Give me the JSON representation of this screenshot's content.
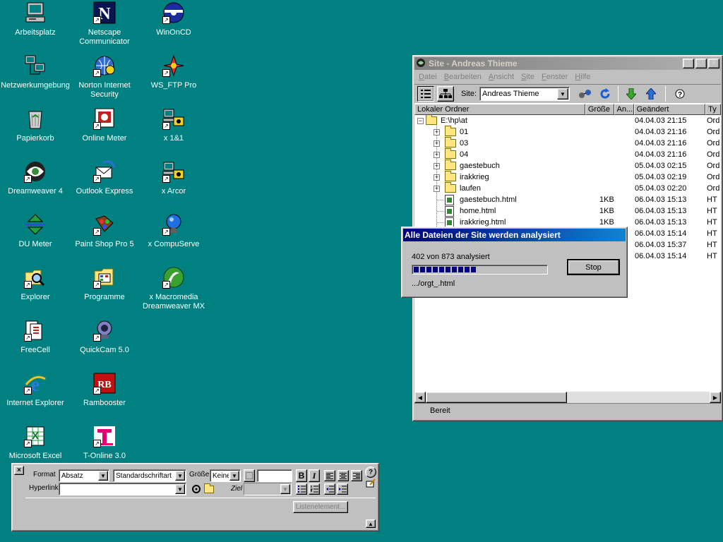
{
  "desktop_icons": [
    {
      "label": "Arbeitsplatz",
      "icon": "my-computer-icon"
    },
    {
      "label": "Netscape Communicator",
      "icon": "netscape-icon"
    },
    {
      "label": "WinOnCD",
      "icon": "winoncd-icon"
    },
    {
      "label": "Netzwerkumgebung",
      "icon": "network-neighborhood-icon"
    },
    {
      "label": "Norton Internet Security",
      "icon": "norton-icon"
    },
    {
      "label": "WS_FTP Pro",
      "icon": "ws-ftp-icon"
    },
    {
      "label": "Papierkorb",
      "icon": "recycle-bin-icon"
    },
    {
      "label": "Online Meter",
      "icon": "online-meter-icon"
    },
    {
      "label": "x 1&1",
      "icon": "dialup-icon"
    },
    {
      "label": "Dreamweaver 4",
      "icon": "dreamweaver-icon"
    },
    {
      "label": "Outlook Express",
      "icon": "outlook-express-icon"
    },
    {
      "label": "x Arcor",
      "icon": "dialup-icon"
    },
    {
      "label": "DU Meter",
      "icon": "du-meter-icon"
    },
    {
      "label": "Paint Shop Pro 5",
      "icon": "paint-shop-pro-icon"
    },
    {
      "label": "x CompuServe",
      "icon": "compuserve-icon"
    },
    {
      "label": "Explorer",
      "icon": "explorer-icon"
    },
    {
      "label": "Programme",
      "icon": "programs-icon"
    },
    {
      "label": "x Macromedia Dreamweaver MX",
      "icon": "dreamweaver-mx-icon"
    },
    {
      "label": "FreeCell",
      "icon": "freecell-icon"
    },
    {
      "label": "QuickCam 5.0",
      "icon": "quickcam-icon"
    },
    {
      "label": "Internet Explorer",
      "icon": "internet-explorer-icon"
    },
    {
      "label": "Rambooster",
      "icon": "rambooster-icon"
    },
    {
      "label": "Microsoft Excel",
      "icon": "excel-icon"
    },
    {
      "label": "T-Online 3.0",
      "icon": "t-online-icon"
    }
  ],
  "site_window": {
    "title": "Site - Andreas Thieme",
    "menu": [
      "Datei",
      "Bearbeiten",
      "Ansicht",
      "Site",
      "Fenster",
      "Hilfe"
    ],
    "site_label": "Site:",
    "site_value": "Andreas Thieme",
    "columns": [
      "Lokaler Ordner",
      "Größe",
      "An...",
      "Geändert",
      "Ty"
    ],
    "rows": [
      {
        "name": "E:\\hp\\at",
        "size": "",
        "date": "04.04.03 21:15",
        "type": "Ord",
        "kind": "folder",
        "level": 0,
        "expander": "−"
      },
      {
        "name": "01",
        "size": "",
        "date": "04.04.03 21:16",
        "type": "Ord",
        "kind": "folder",
        "level": 1,
        "expander": "+"
      },
      {
        "name": "03",
        "size": "",
        "date": "04.04.03 21:16",
        "type": "Ord",
        "kind": "folder",
        "level": 1,
        "expander": "+"
      },
      {
        "name": "04",
        "size": "",
        "date": "04.04.03 21:16",
        "type": "Ord",
        "kind": "folder",
        "level": 1,
        "expander": "+"
      },
      {
        "name": "gaestebuch",
        "size": "",
        "date": "05.04.03 02:15",
        "type": "Ord",
        "kind": "folder",
        "level": 1,
        "expander": "+"
      },
      {
        "name": "irakkrieg",
        "size": "",
        "date": "05.04.03 02:19",
        "type": "Ord",
        "kind": "folder",
        "level": 1,
        "expander": "+"
      },
      {
        "name": "laufen",
        "size": "",
        "date": "05.04.03 02:20",
        "type": "Ord",
        "kind": "folder",
        "level": 1,
        "expander": "+"
      },
      {
        "name": "gaestebuch.html",
        "size": "1KB",
        "date": "06.04.03 15:13",
        "type": "HT",
        "kind": "file",
        "level": 1,
        "expander": ""
      },
      {
        "name": "home.html",
        "size": "1KB",
        "date": "06.04.03 15:13",
        "type": "HT",
        "kind": "file",
        "level": 1,
        "expander": ""
      },
      {
        "name": "irakkrieg.html",
        "size": "1KB",
        "date": "06.04.03 15:13",
        "type": "HT",
        "kind": "file",
        "level": 1,
        "expander": ""
      },
      {
        "name": "",
        "size": "",
        "date": "06.04.03 15:14",
        "type": "HT",
        "kind": "file",
        "level": 1,
        "expander": ""
      },
      {
        "name": "",
        "size": "",
        "date": "06.04.03 15:37",
        "type": "HT",
        "kind": "file",
        "level": 1,
        "expander": ""
      },
      {
        "name": "",
        "size": "",
        "date": "06.04.03 15:14",
        "type": "HT",
        "kind": "file",
        "level": 1,
        "expander": ""
      }
    ],
    "status": "Bereit"
  },
  "progress_dialog": {
    "title": "Alle Dateien der Site werden analysiert",
    "message": "402 von 873 analysiert",
    "progress_fraction": 0.46,
    "current_file": ".../orgt_.html",
    "stop_label": "Stop"
  },
  "properties": {
    "format_label": "Format",
    "format_value": "Absatz",
    "font_value": "Standardschriftart",
    "size_label": "Größe",
    "size_value": "Keine",
    "hyperlink_label": "Hyperlink",
    "hyperlink_value": "",
    "target_label": "Ziel",
    "target_value": "",
    "list_item_label": "Listenelement...",
    "bold": "B",
    "italic": "I"
  },
  "colors": {
    "desktop": "#008080",
    "title_active": "#000080",
    "title_inactive": "#808080",
    "progress": "#000080"
  }
}
